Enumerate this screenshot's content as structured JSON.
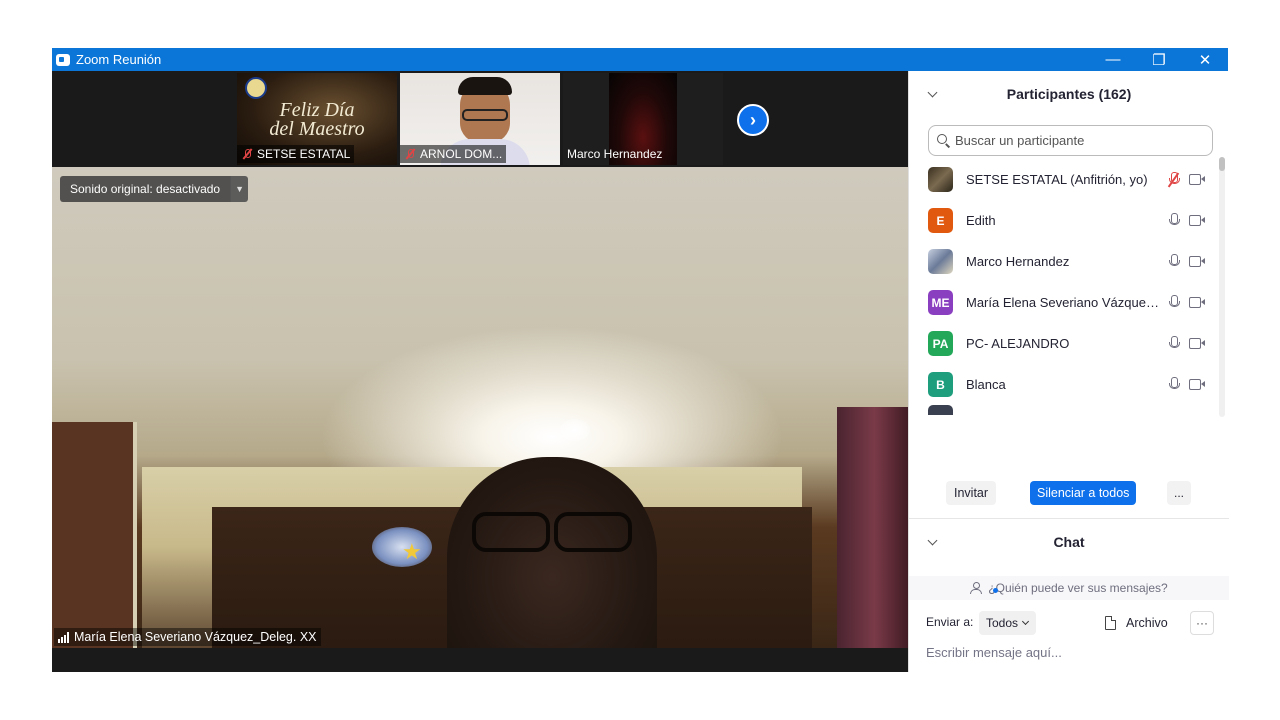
{
  "window": {
    "title": "Zoom Reunión",
    "controls": {
      "minimize": "—",
      "restore": "❐",
      "close": "✕"
    }
  },
  "thumbnails": [
    {
      "name": "SETSE ESTATAL",
      "muted": true,
      "banner_line1": "Feliz Día",
      "banner_line2": "del Maestro"
    },
    {
      "name": "ARNOL DOM...",
      "muted": true
    },
    {
      "name": "Marco Hernandez",
      "muted": false
    }
  ],
  "thumbnails_next_icon": "chevron-right-icon",
  "main_video": {
    "original_sound_label": "Sonido original: desactivado",
    "speaker_name": "María Elena Severiano Vázquez_Deleg. XX"
  },
  "participants_panel": {
    "title": "Participantes (162)",
    "search_placeholder": "Buscar un participante",
    "participants": [
      {
        "name": "SETSE ESTATAL (Anfitrión, yo)",
        "initials": "",
        "avatar_color": "#5a4a3a",
        "muted": true
      },
      {
        "name": "Edith",
        "initials": "E",
        "avatar_color": "#e0590e",
        "muted": false
      },
      {
        "name": "Marco Hernandez",
        "initials": "",
        "avatar_color": "#7a8aa0",
        "muted": false
      },
      {
        "name": "María Elena Severiano Vázquez...",
        "initials": "ME",
        "avatar_color": "#8a3fc0",
        "muted": false
      },
      {
        "name": "PC- ALEJANDRO",
        "initials": "PA",
        "avatar_color": "#23a85a",
        "muted": false
      },
      {
        "name": "Blanca",
        "initials": "B",
        "avatar_color": "#1f9e7e",
        "muted": false
      }
    ],
    "invite_label": "Invitar",
    "mute_all_label": "Silenciar a todos",
    "more_label": "..."
  },
  "chat_panel": {
    "title": "Chat",
    "who_can_see": "¿Quién puede ver sus mensajes?",
    "send_to_label": "Enviar a:",
    "send_to_value": "Todos",
    "file_label": "Archivo",
    "more_label": "···",
    "input_placeholder": "Escribir mensaje aquí..."
  },
  "colors": {
    "titlebar": "#0b76d8",
    "accent": "#0e71eb",
    "muted_red": "#e04545"
  }
}
